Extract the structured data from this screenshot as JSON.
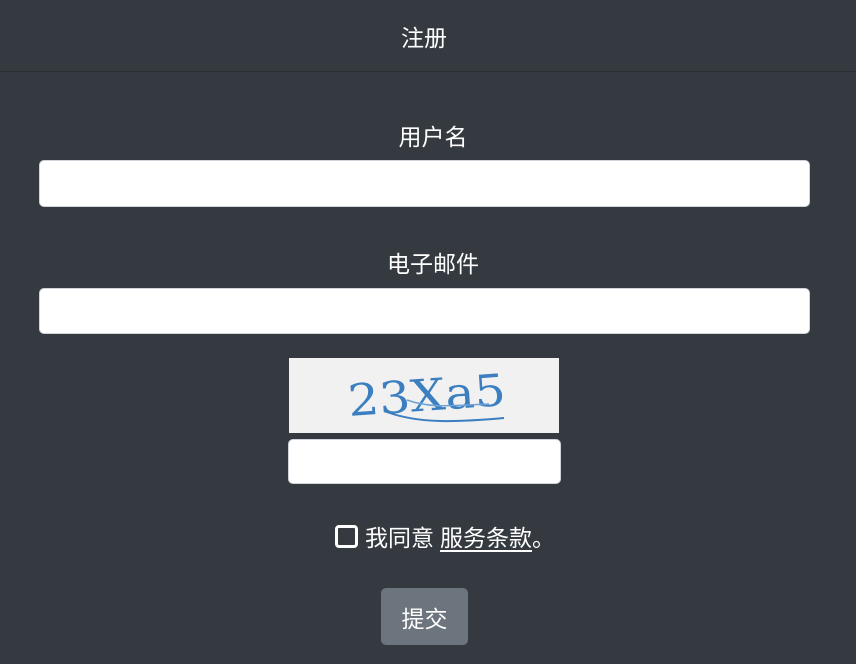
{
  "header": {
    "title": "注册"
  },
  "form": {
    "username_label": "用户名",
    "username_value": "",
    "email_label": "电子邮件",
    "email_value": "",
    "captcha_text": "23Xa5",
    "captcha_value": "",
    "agree": {
      "checked": false,
      "text": "我同意",
      "link_text": "服务条款",
      "suffix": "。"
    },
    "submit_label": "提交"
  },
  "colors": {
    "background": "#343a40",
    "input_background": "#ffffff",
    "button_background": "#6c757d",
    "captcha_background": "#f1f1f1",
    "captcha_text": "#3b7fc0"
  }
}
